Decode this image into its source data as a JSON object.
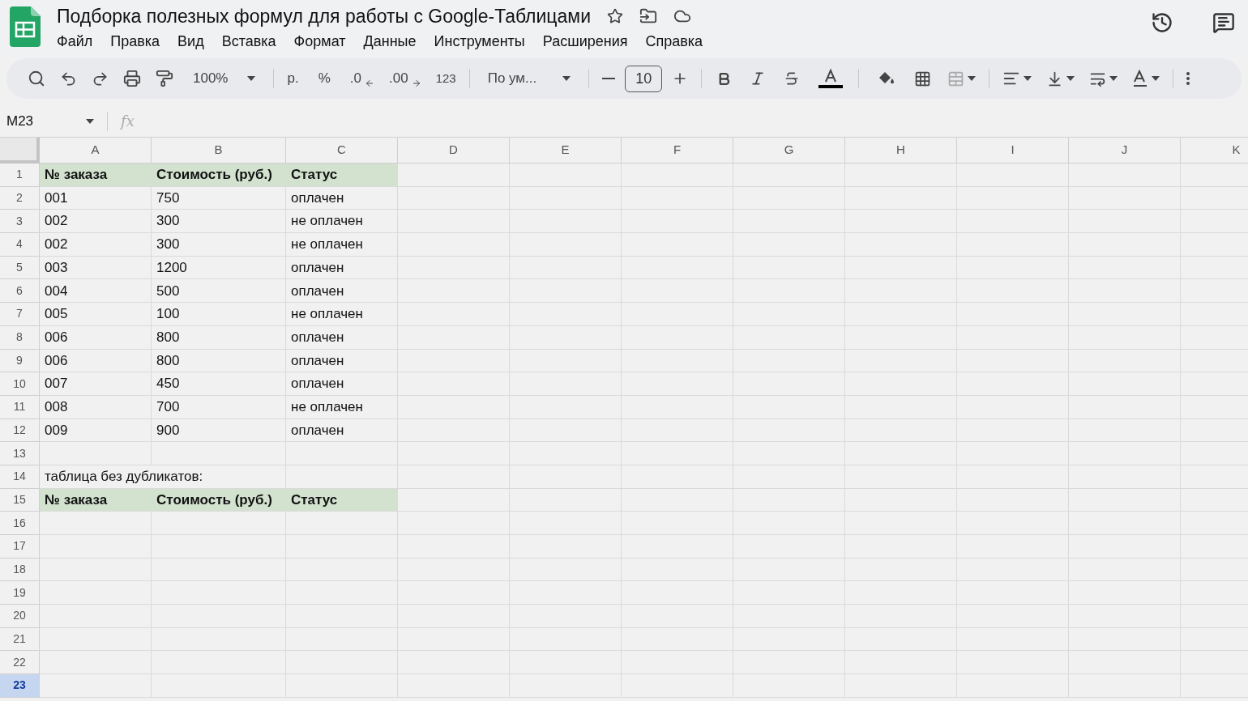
{
  "document": {
    "title": "Подборка полезных формул для работы с Google-Таблицами"
  },
  "menu": [
    "Файл",
    "Правка",
    "Вид",
    "Вставка",
    "Формат",
    "Данные",
    "Инструменты",
    "Расширения",
    "Справка"
  ],
  "toolbar": {
    "zoom": "100%",
    "currency": "р.",
    "percent": "%",
    "decrease_decimals": ".0",
    "increase_decimals": ".00",
    "number_format": "123",
    "font": "По ум...",
    "font_size": "10"
  },
  "formula_bar": {
    "cell_reference": "M23",
    "function_label": "fx"
  },
  "columns": [
    "A",
    "B",
    "C",
    "D",
    "E",
    "F",
    "G",
    "H",
    "I",
    "J",
    "K"
  ],
  "rows": [
    {
      "number": "1",
      "selected": false,
      "kind": "header",
      "cells": [
        "№ заказа",
        "Стоимость (руб.)",
        "Статус"
      ]
    },
    {
      "number": "2",
      "selected": false,
      "kind": "data",
      "cells": [
        "001",
        "750",
        "оплачен"
      ]
    },
    {
      "number": "3",
      "selected": false,
      "kind": "data",
      "cells": [
        "002",
        "300",
        "не оплачен"
      ]
    },
    {
      "number": "4",
      "selected": false,
      "kind": "data",
      "cells": [
        "002",
        "300",
        "не оплачен"
      ]
    },
    {
      "number": "5",
      "selected": false,
      "kind": "data",
      "cells": [
        "003",
        "1200",
        "оплачен"
      ]
    },
    {
      "number": "6",
      "selected": false,
      "kind": "data",
      "cells": [
        "004",
        "500",
        "оплачен"
      ]
    },
    {
      "number": "7",
      "selected": false,
      "kind": "data",
      "cells": [
        "005",
        "100",
        "не оплачен"
      ]
    },
    {
      "number": "8",
      "selected": false,
      "kind": "data",
      "cells": [
        "006",
        "800",
        "оплачен"
      ]
    },
    {
      "number": "9",
      "selected": false,
      "kind": "data",
      "cells": [
        "006",
        "800",
        "оплачен"
      ]
    },
    {
      "number": "10",
      "selected": false,
      "kind": "data",
      "cells": [
        "007",
        "450",
        "оплачен"
      ]
    },
    {
      "number": "11",
      "selected": false,
      "kind": "data",
      "cells": [
        "008",
        "700",
        "не оплачен"
      ]
    },
    {
      "number": "12",
      "selected": false,
      "kind": "data",
      "cells": [
        "009",
        "900",
        "оплачен"
      ]
    },
    {
      "number": "13",
      "selected": false,
      "kind": "empty"
    },
    {
      "number": "14",
      "selected": false,
      "kind": "note",
      "cells": [
        "таблица без дубликатов:"
      ]
    },
    {
      "number": "15",
      "selected": false,
      "kind": "header",
      "cells": [
        "№ заказа",
        "Стоимость (руб.)",
        "Статус"
      ]
    },
    {
      "number": "16",
      "selected": false,
      "kind": "empty"
    },
    {
      "number": "17",
      "selected": false,
      "kind": "empty"
    },
    {
      "number": "18",
      "selected": false,
      "kind": "empty"
    },
    {
      "number": "19",
      "selected": false,
      "kind": "empty"
    },
    {
      "number": "20",
      "selected": false,
      "kind": "empty"
    },
    {
      "number": "21",
      "selected": false,
      "kind": "empty"
    },
    {
      "number": "22",
      "selected": false,
      "kind": "empty"
    },
    {
      "number": "23",
      "selected": true,
      "kind": "empty"
    }
  ]
}
